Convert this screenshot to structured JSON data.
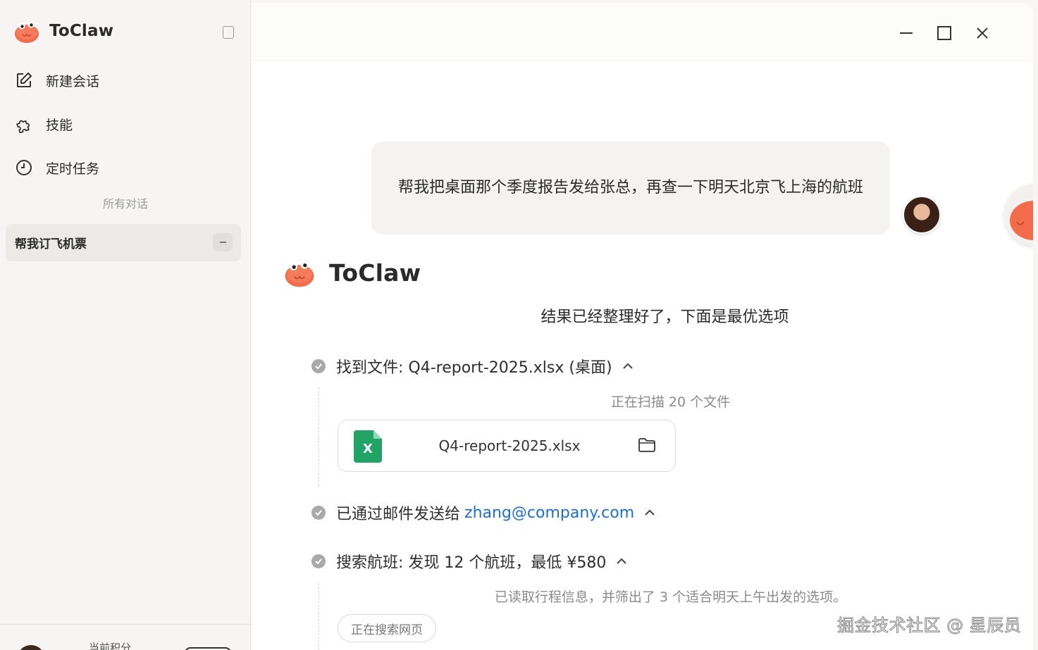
{
  "app": {
    "name": "ToClaw"
  },
  "sidebar": {
    "nav": [
      {
        "label": "新建会话",
        "icon": "edit-icon"
      },
      {
        "label": "技能",
        "icon": "puzzle-icon"
      },
      {
        "label": "定时任务",
        "icon": "clock-icon"
      }
    ],
    "section_label": "所有对话",
    "conversations": [
      {
        "title": "帮我订飞机票"
      }
    ],
    "footer": {
      "text": "当前积分"
    }
  },
  "chat": {
    "user_message": "帮我把桌面那个季度报告发给张总，再查一下明天北京飞上海的航班",
    "bot_name": "ToClaw",
    "result_text": "结果已经整理好了，下面是最优选项",
    "steps": [
      {
        "label": "找到文件: Q4-report-2025.xlsx (桌面)",
        "status": "done",
        "sub": "正在扫描 20 个文件"
      },
      {
        "label_prefix": "已通过邮件发送给",
        "email": "zhang@company.com",
        "status": "done"
      },
      {
        "label": "搜索航班: 发现 12 个航班，最低 ¥580",
        "status": "done",
        "sub": "已读取行程信息，并筛出了 3 个适合明天上午出发的选项。"
      }
    ],
    "file_card": {
      "name": "Q4-report-2025.xlsx",
      "icon_letter": "X"
    },
    "search_chip": "正在搜索网页"
  },
  "colors": {
    "accent_link": "#1b6fd6",
    "excel_green": "#21a366",
    "mascot": "#f26b4b"
  },
  "watermark": "掘金技术社区 @ 星辰员"
}
